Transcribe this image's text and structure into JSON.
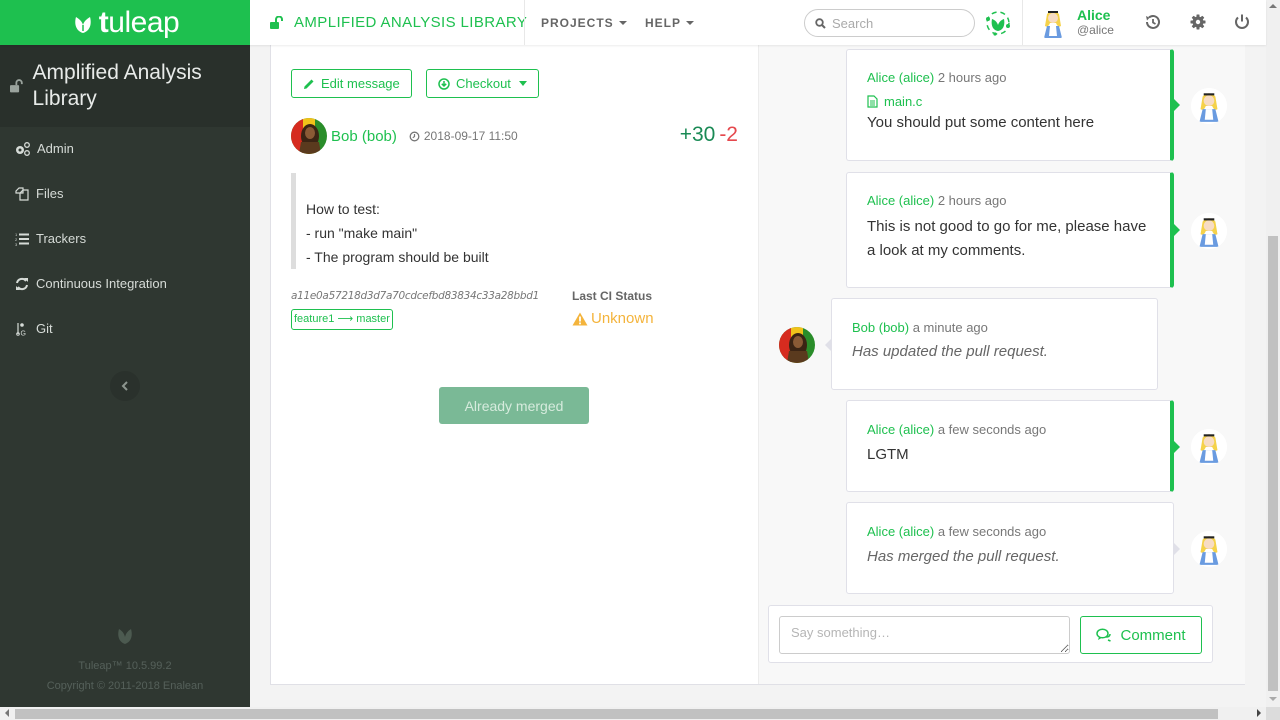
{
  "brand": {
    "logo_text_bold": "t",
    "logo_text_rest": "uleap",
    "accent_color": "#1ec04f"
  },
  "header": {
    "project_name": "AMPLIFIED ANALYSIS LIBRARY",
    "menus": [
      {
        "label": "PROJECTS"
      },
      {
        "label": "HELP"
      }
    ],
    "search_placeholder": "Search",
    "user": {
      "name": "Alice",
      "handle": "@alice"
    },
    "icons": [
      "history-icon",
      "gear-icon",
      "power-icon"
    ]
  },
  "sidebar": {
    "project_name": "Amplified Analysis Library",
    "items": [
      {
        "label": "Admin",
        "icon": "cogs-icon"
      },
      {
        "label": "Files",
        "icon": "files-icon"
      },
      {
        "label": "Trackers",
        "icon": "list-ol-icon"
      },
      {
        "label": "Continuous Integration",
        "icon": "refresh-icon"
      },
      {
        "label": "Git",
        "icon": "git-icon"
      }
    ],
    "footer": {
      "version": "Tuleap™ 10.5.99.2",
      "copyright": "Copyright © 2011-2018 Enalean"
    }
  },
  "pull_request": {
    "actions": {
      "edit_message": "Edit message",
      "checkout": "Checkout"
    },
    "author": "Bob (bob)",
    "date": "2018-09-17 11:50",
    "additions": "+30",
    "deletions": "-2",
    "description_lines": [
      "How to test:",
      "- run \"make main\"",
      "- The program should be built"
    ],
    "commit_sha": "a11e0a57218d3d7a70cdcefbd83834c33a28bbd1",
    "source_branch": "feature1",
    "destination_branch": "master",
    "branch_arrow": "⟶",
    "ci": {
      "label": "Last CI Status",
      "status": "Unknown",
      "status_color": "#f4b43c"
    },
    "merge_button": "Already merged"
  },
  "timeline": [
    {
      "author": "Alice (alice)",
      "time": "2 hours ago",
      "file": "main.c",
      "text": "You should put some content here",
      "side": "right",
      "type": "inline-comment"
    },
    {
      "author": "Alice (alice)",
      "time": "2 hours ago",
      "text": "This is not good to go for me, please have a look at my comments.",
      "side": "right",
      "type": "comment"
    },
    {
      "author": "Bob (bob)",
      "time": "a minute ago",
      "text": "Has updated the pull request.",
      "side": "left",
      "type": "event"
    },
    {
      "author": "Alice (alice)",
      "time": "a few seconds ago",
      "text": "LGTM",
      "side": "right",
      "type": "comment"
    },
    {
      "author": "Alice (alice)",
      "time": "a few seconds ago",
      "text": "Has merged the pull request.",
      "side": "right",
      "type": "event"
    }
  ],
  "reply": {
    "placeholder": "Say something…",
    "submit_label": "Comment"
  }
}
